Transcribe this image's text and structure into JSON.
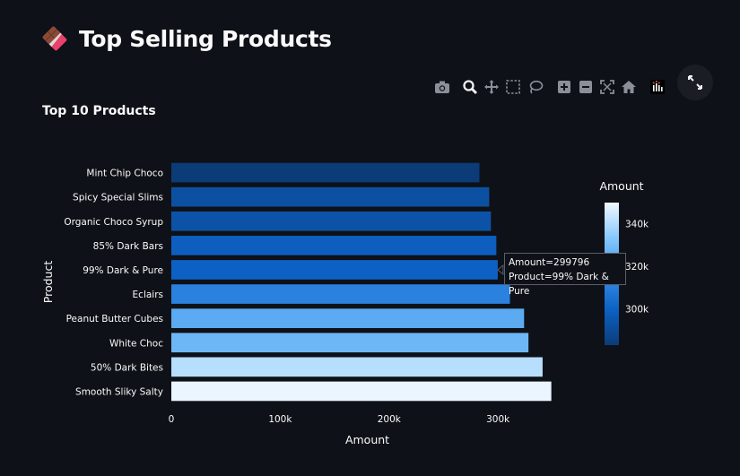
{
  "page": {
    "title": "Top Selling Products",
    "icon": "chocolate-bar-icon"
  },
  "toolbar": {
    "buttons": [
      "camera-icon",
      "zoom-icon",
      "pan-icon",
      "box-select-icon",
      "lasso-select-icon",
      "zoom-in-icon",
      "zoom-out-icon",
      "autoscale-icon",
      "reset-axes-icon",
      "plotly-logo-icon"
    ],
    "fullscreen": "expand-icon"
  },
  "tooltip": {
    "line1": "Amount=299796",
    "line2": "Product=99% Dark & Pure"
  },
  "chart_data": {
    "type": "bar",
    "orientation": "horizontal",
    "title": "Top 10 Products",
    "xlabel": "Amount",
    "ylabel": "Product",
    "xlim": [
      0,
      360000
    ],
    "x_ticks": [
      {
        "value": 0,
        "label": "0"
      },
      {
        "value": 100000,
        "label": "100k"
      },
      {
        "value": 200000,
        "label": "200k"
      },
      {
        "value": 300000,
        "label": "300k"
      }
    ],
    "categories": [
      "Mint Chip Choco",
      "Spicy Special Slims",
      "Organic Choco Syrup",
      "85% Dark Bars",
      "99% Dark & Pure",
      "Eclairs",
      "Peanut Butter Cubes",
      "White Choc",
      "50% Dark Bites",
      "Smooth Sliky Salty"
    ],
    "values": [
      283000,
      292000,
      293500,
      298500,
      299796,
      311000,
      324000,
      328000,
      341000,
      349000
    ],
    "colorscale": [
      "#0b3c78",
      "#0d61c4",
      "#3891ea",
      "#86c8fb",
      "#f0f8ff"
    ],
    "colorbar": {
      "title": "Amount",
      "range": [
        283000,
        350000
      ],
      "ticks": [
        {
          "value": 300000,
          "label": "300k"
        },
        {
          "value": 320000,
          "label": "320k"
        },
        {
          "value": 340000,
          "label": "340k"
        }
      ]
    },
    "grid": false
  }
}
